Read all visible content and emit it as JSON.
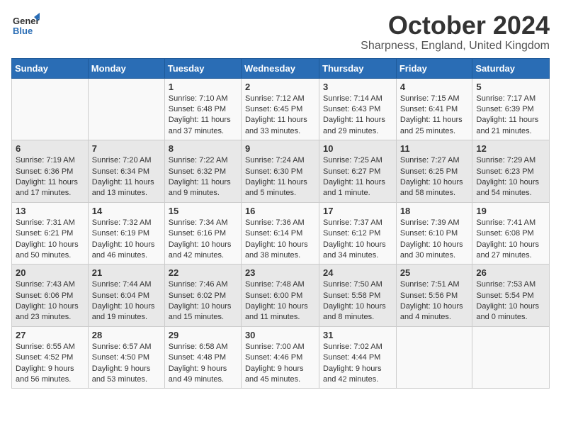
{
  "logo": {
    "general": "General",
    "blue": "Blue"
  },
  "title": "October 2024",
  "location": "Sharpness, England, United Kingdom",
  "days_of_week": [
    "Sunday",
    "Monday",
    "Tuesday",
    "Wednesday",
    "Thursday",
    "Friday",
    "Saturday"
  ],
  "weeks": [
    [
      {
        "day": "",
        "info": ""
      },
      {
        "day": "",
        "info": ""
      },
      {
        "day": "1",
        "info": "Sunrise: 7:10 AM\nSunset: 6:48 PM\nDaylight: 11 hours and 37 minutes."
      },
      {
        "day": "2",
        "info": "Sunrise: 7:12 AM\nSunset: 6:45 PM\nDaylight: 11 hours and 33 minutes."
      },
      {
        "day": "3",
        "info": "Sunrise: 7:14 AM\nSunset: 6:43 PM\nDaylight: 11 hours and 29 minutes."
      },
      {
        "day": "4",
        "info": "Sunrise: 7:15 AM\nSunset: 6:41 PM\nDaylight: 11 hours and 25 minutes."
      },
      {
        "day": "5",
        "info": "Sunrise: 7:17 AM\nSunset: 6:39 PM\nDaylight: 11 hours and 21 minutes."
      }
    ],
    [
      {
        "day": "6",
        "info": "Sunrise: 7:19 AM\nSunset: 6:36 PM\nDaylight: 11 hours and 17 minutes."
      },
      {
        "day": "7",
        "info": "Sunrise: 7:20 AM\nSunset: 6:34 PM\nDaylight: 11 hours and 13 minutes."
      },
      {
        "day": "8",
        "info": "Sunrise: 7:22 AM\nSunset: 6:32 PM\nDaylight: 11 hours and 9 minutes."
      },
      {
        "day": "9",
        "info": "Sunrise: 7:24 AM\nSunset: 6:30 PM\nDaylight: 11 hours and 5 minutes."
      },
      {
        "day": "10",
        "info": "Sunrise: 7:25 AM\nSunset: 6:27 PM\nDaylight: 11 hours and 1 minute."
      },
      {
        "day": "11",
        "info": "Sunrise: 7:27 AM\nSunset: 6:25 PM\nDaylight: 10 hours and 58 minutes."
      },
      {
        "day": "12",
        "info": "Sunrise: 7:29 AM\nSunset: 6:23 PM\nDaylight: 10 hours and 54 minutes."
      }
    ],
    [
      {
        "day": "13",
        "info": "Sunrise: 7:31 AM\nSunset: 6:21 PM\nDaylight: 10 hours and 50 minutes."
      },
      {
        "day": "14",
        "info": "Sunrise: 7:32 AM\nSunset: 6:19 PM\nDaylight: 10 hours and 46 minutes."
      },
      {
        "day": "15",
        "info": "Sunrise: 7:34 AM\nSunset: 6:16 PM\nDaylight: 10 hours and 42 minutes."
      },
      {
        "day": "16",
        "info": "Sunrise: 7:36 AM\nSunset: 6:14 PM\nDaylight: 10 hours and 38 minutes."
      },
      {
        "day": "17",
        "info": "Sunrise: 7:37 AM\nSunset: 6:12 PM\nDaylight: 10 hours and 34 minutes."
      },
      {
        "day": "18",
        "info": "Sunrise: 7:39 AM\nSunset: 6:10 PM\nDaylight: 10 hours and 30 minutes."
      },
      {
        "day": "19",
        "info": "Sunrise: 7:41 AM\nSunset: 6:08 PM\nDaylight: 10 hours and 27 minutes."
      }
    ],
    [
      {
        "day": "20",
        "info": "Sunrise: 7:43 AM\nSunset: 6:06 PM\nDaylight: 10 hours and 23 minutes."
      },
      {
        "day": "21",
        "info": "Sunrise: 7:44 AM\nSunset: 6:04 PM\nDaylight: 10 hours and 19 minutes."
      },
      {
        "day": "22",
        "info": "Sunrise: 7:46 AM\nSunset: 6:02 PM\nDaylight: 10 hours and 15 minutes."
      },
      {
        "day": "23",
        "info": "Sunrise: 7:48 AM\nSunset: 6:00 PM\nDaylight: 10 hours and 11 minutes."
      },
      {
        "day": "24",
        "info": "Sunrise: 7:50 AM\nSunset: 5:58 PM\nDaylight: 10 hours and 8 minutes."
      },
      {
        "day": "25",
        "info": "Sunrise: 7:51 AM\nSunset: 5:56 PM\nDaylight: 10 hours and 4 minutes."
      },
      {
        "day": "26",
        "info": "Sunrise: 7:53 AM\nSunset: 5:54 PM\nDaylight: 10 hours and 0 minutes."
      }
    ],
    [
      {
        "day": "27",
        "info": "Sunrise: 6:55 AM\nSunset: 4:52 PM\nDaylight: 9 hours and 56 minutes."
      },
      {
        "day": "28",
        "info": "Sunrise: 6:57 AM\nSunset: 4:50 PM\nDaylight: 9 hours and 53 minutes."
      },
      {
        "day": "29",
        "info": "Sunrise: 6:58 AM\nSunset: 4:48 PM\nDaylight: 9 hours and 49 minutes."
      },
      {
        "day": "30",
        "info": "Sunrise: 7:00 AM\nSunset: 4:46 PM\nDaylight: 9 hours and 45 minutes."
      },
      {
        "day": "31",
        "info": "Sunrise: 7:02 AM\nSunset: 4:44 PM\nDaylight: 9 hours and 42 minutes."
      },
      {
        "day": "",
        "info": ""
      },
      {
        "day": "",
        "info": ""
      }
    ]
  ]
}
